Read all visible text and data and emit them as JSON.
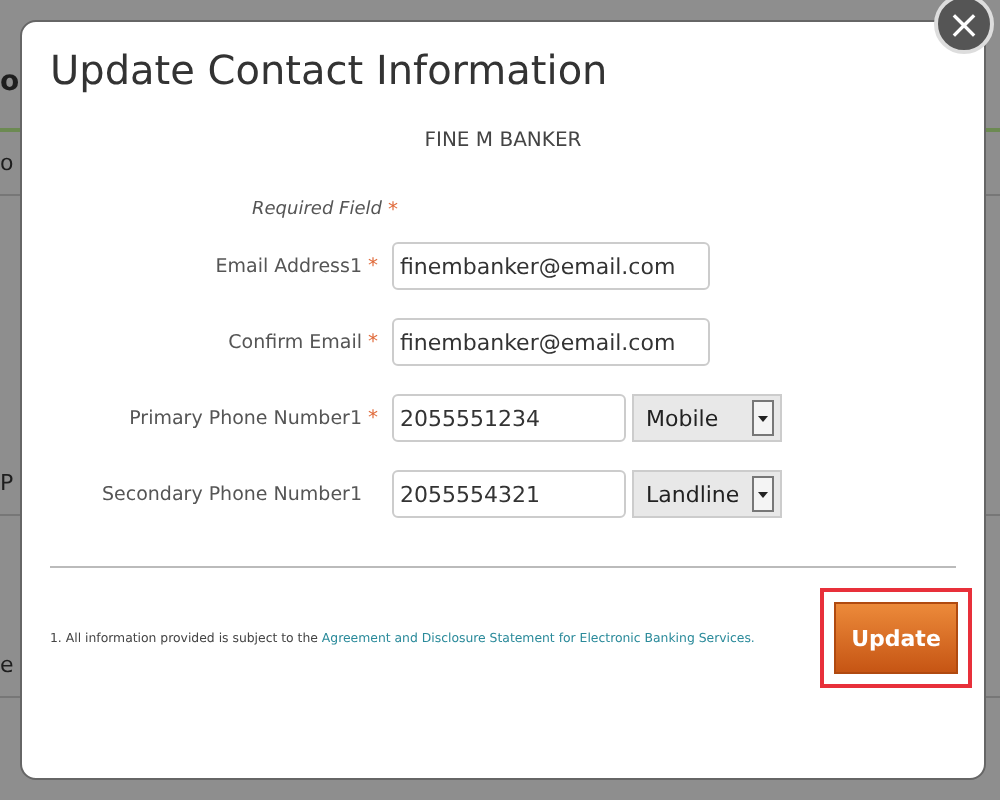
{
  "background": {
    "heading": "o",
    "subheading": "o",
    "items": [
      {
        "text": "P"
      },
      {
        "text": "e"
      }
    ]
  },
  "dialog": {
    "title": "Update Contact Information",
    "customer_name": "FINE M BANKER",
    "required_note": {
      "label": "Required Field",
      "marker": "*"
    },
    "fields": [
      {
        "kind": "text",
        "label": "Email Address1",
        "marker": "*",
        "value": "finembanker@email.com"
      },
      {
        "kind": "text",
        "label": "Confirm Email",
        "marker": "*",
        "value": "finembanker@email.com"
      },
      {
        "kind": "phone",
        "label": "Primary Phone Number1",
        "marker": "*",
        "value": "2055551234",
        "phone_type": "Mobile"
      },
      {
        "kind": "phone",
        "label": "Secondary Phone Number1",
        "value": "2055554321",
        "phone_type": "Landline"
      }
    ],
    "footnote": {
      "text": "1. All information provided is subject to the",
      "link": "Agreement and Disclosure Statement for Electronic Banking Services."
    },
    "update_button": {
      "label": "Update",
      "highlighted": true
    },
    "close_button": {
      "label": "×"
    }
  }
}
